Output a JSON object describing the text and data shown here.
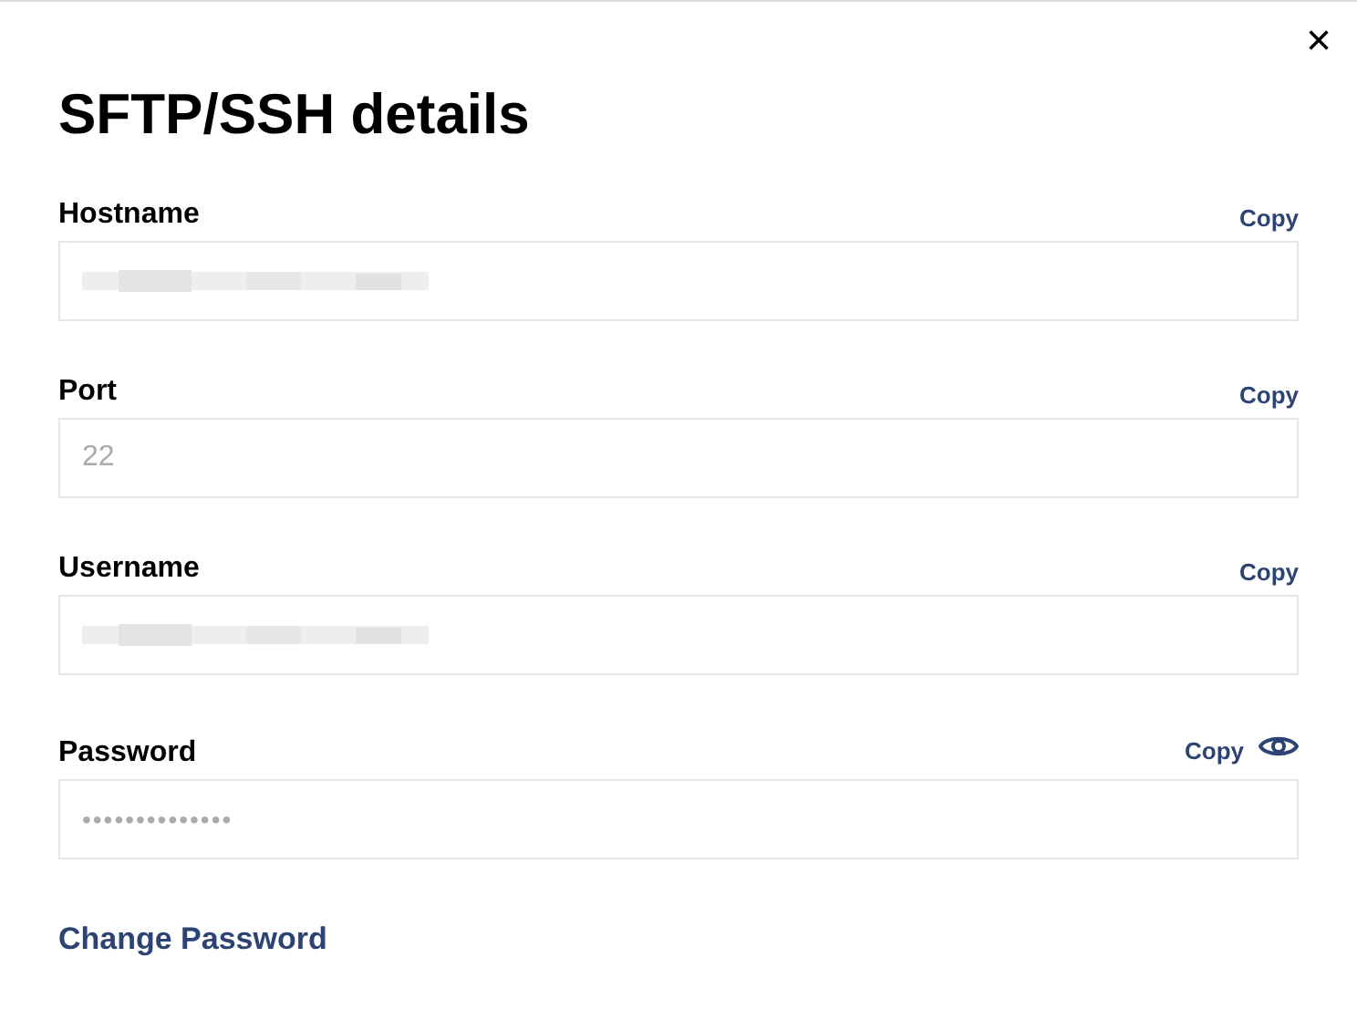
{
  "dialog": {
    "title": "SFTP/SSH details",
    "close": "×"
  },
  "fields": [
    {
      "kind": "text",
      "label": "Hostname",
      "copy": "Copy",
      "redacted": true
    },
    {
      "kind": "text",
      "label": "Port",
      "copy": "Copy",
      "value": "22"
    },
    {
      "kind": "text",
      "label": "Username",
      "copy": "Copy",
      "redacted": true
    },
    {
      "kind": "password",
      "label": "Password",
      "copy": "Copy",
      "value": "••••••••••••••",
      "reveal_toggle": true
    }
  ],
  "link": "Change Password"
}
